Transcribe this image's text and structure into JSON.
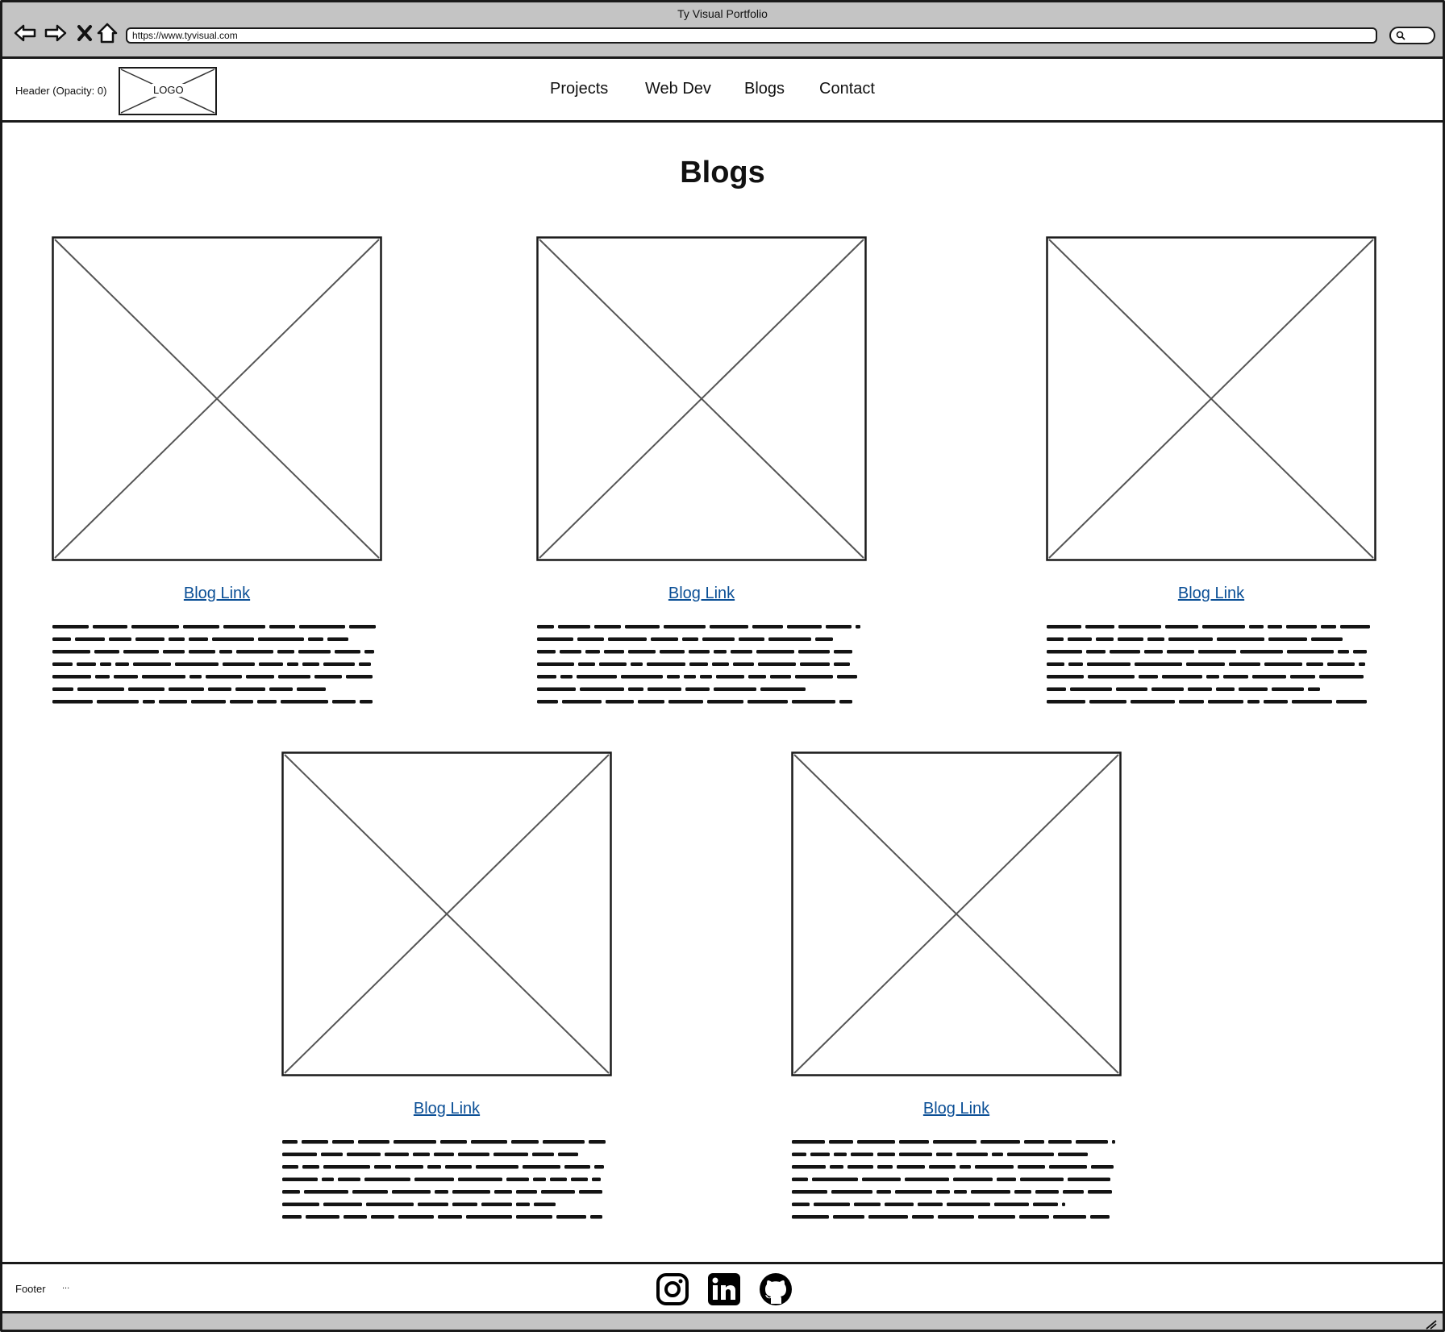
{
  "browser": {
    "window_title": "Ty Visual Portfolio",
    "url": "https://www.tyvisual.com"
  },
  "header": {
    "note": "Header (Opacity: 0)",
    "logo_text": "LOGO",
    "nav": [
      "Projects",
      "Web Dev",
      "Blogs",
      "Contact"
    ]
  },
  "page": {
    "title": "Blogs"
  },
  "blogs": [
    {
      "link": "Blog Link"
    },
    {
      "link": "Blog Link"
    },
    {
      "link": "Blog Link"
    },
    {
      "link": "Blog Link"
    },
    {
      "link": "Blog Link"
    }
  ],
  "footer": {
    "label": "Footer",
    "dots": "...",
    "icons": [
      "instagram-icon",
      "linkedin-icon",
      "github-icon"
    ]
  }
}
